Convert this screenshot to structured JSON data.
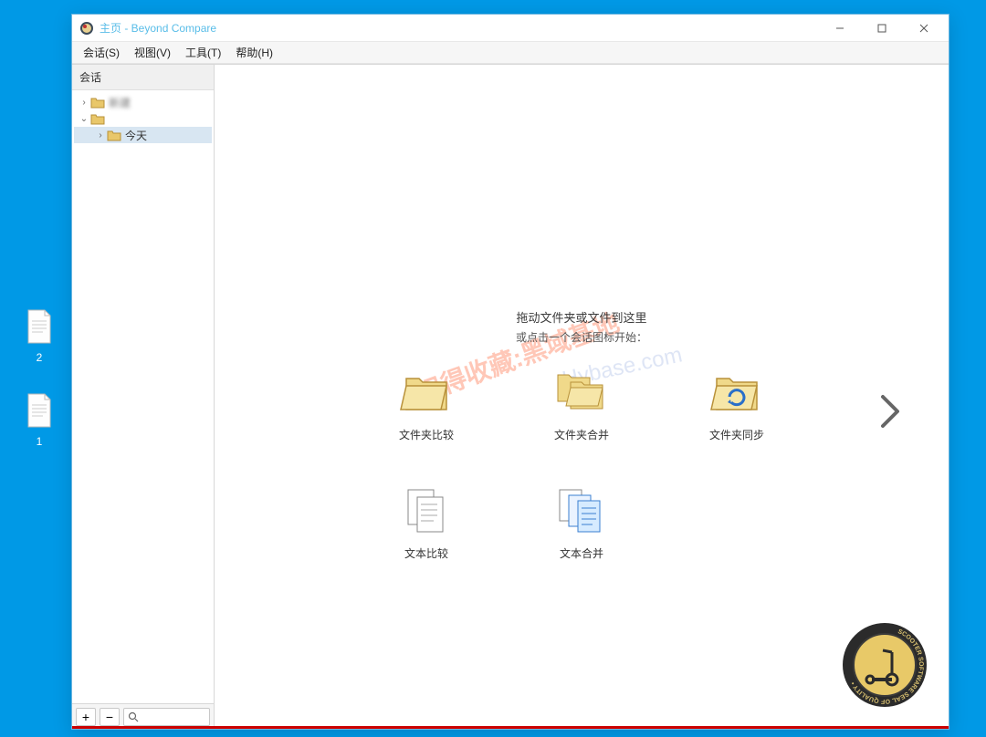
{
  "desktop": {
    "icons": [
      {
        "label": "2"
      },
      {
        "label": "1"
      }
    ]
  },
  "window": {
    "title": "主页 - Beyond Compare",
    "menu": [
      "会话(S)",
      "视图(V)",
      "工具(T)",
      "帮助(H)"
    ],
    "sidebar": {
      "header": "会话",
      "tree": {
        "item0": "新建",
        "item1": "",
        "item2": "今天"
      },
      "footer": {
        "plus": "+",
        "minus": "−"
      }
    },
    "main": {
      "drop_title": "拖动文件夹或文件到这里",
      "drop_sub": "或点击一个会话图标开始：",
      "sessions": {
        "folder_compare": "文件夹比较",
        "folder_merge": "文件夹合并",
        "folder_sync": "文件夹同步",
        "text_compare": "文本比较",
        "text_merge": "文本合并"
      }
    },
    "watermark": "记得收藏:黑域基地",
    "watermark_url": "Hybase.com",
    "seal": "SCOOTER SOFTWARE SEAL OF QUALITY"
  }
}
